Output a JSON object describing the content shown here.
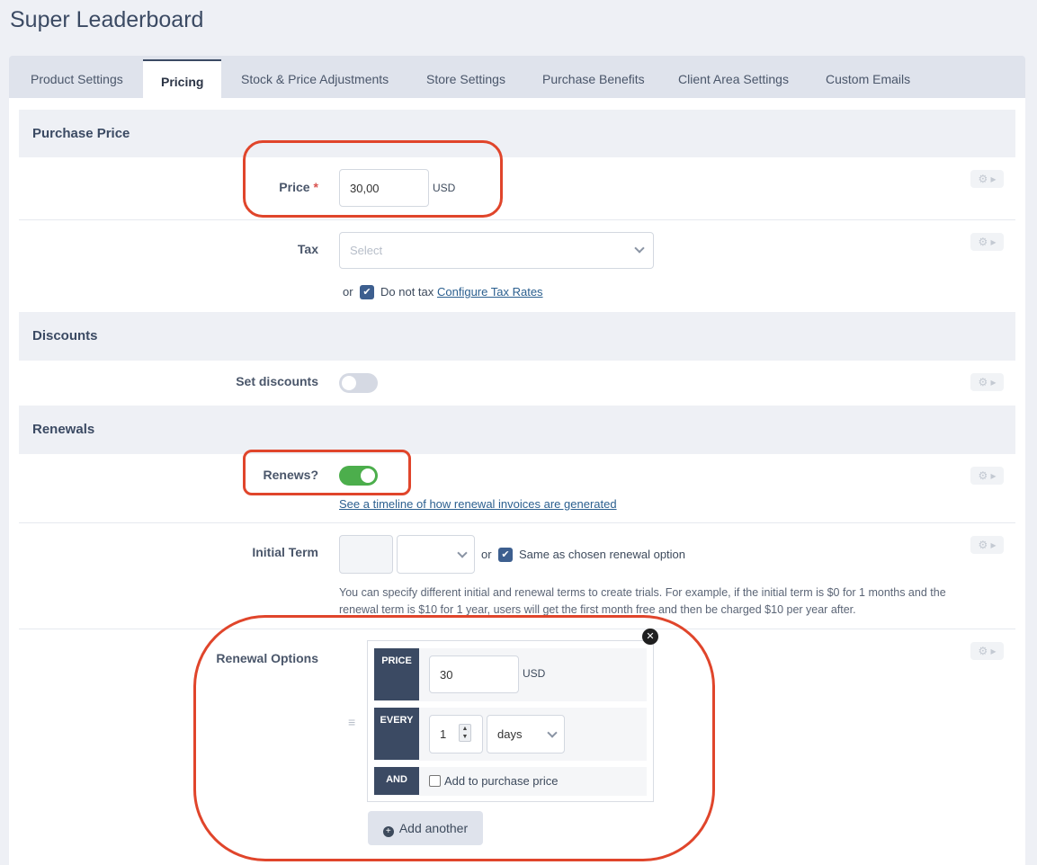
{
  "page": {
    "title": "Super Leaderboard"
  },
  "tabs": [
    {
      "label": "Product Settings"
    },
    {
      "label": "Pricing"
    },
    {
      "label": "Stock & Price Adjustments"
    },
    {
      "label": "Store Settings"
    },
    {
      "label": "Purchase Benefits"
    },
    {
      "label": "Client Area Settings"
    },
    {
      "label": "Custom Emails"
    }
  ],
  "active_tab": "Pricing",
  "purchase_price": {
    "section_title": "Purchase Price",
    "price_label": "Price",
    "required_mark": "*",
    "price_value": "30,00",
    "currency": "USD",
    "tax_label": "Tax",
    "tax_placeholder": "Select",
    "or_text": "or",
    "do_not_tax_label": "Do not tax",
    "do_not_tax_checked": true,
    "configure_tax_link": "Configure Tax Rates"
  },
  "discounts": {
    "section_title": "Discounts",
    "set_discounts_label": "Set discounts",
    "enabled": false
  },
  "renewals": {
    "section_title": "Renewals",
    "renews_label": "Renews?",
    "renews_enabled": true,
    "timeline_link": "See a timeline of how renewal invoices are generated",
    "initial_term_label": "Initial Term",
    "or_text": "or",
    "same_as_renewal_label": "Same as chosen renewal option",
    "same_as_renewal_checked": true,
    "help_text": "You can specify different initial and renewal terms to create trials. For example, if the initial term is $0 for 1 months and the renewal term is $10 for 1 year, users will get the first month free and then be charged $10 per year after.",
    "renewal_options_label": "Renewal Options",
    "option": {
      "price_tag": "PRICE",
      "price_value": "30",
      "currency": "USD",
      "every_tag": "EVERY",
      "every_value": "1",
      "period": "days",
      "and_tag": "AND",
      "add_to_purchase_label": "Add to purchase price",
      "add_to_purchase_checked": false
    },
    "add_another_label": "Add another"
  },
  "colors": {
    "accent": "#3b4a63",
    "toggle_on": "#4cae4c",
    "toggle_off": "#d5d9e3",
    "annotation": "#e0452b"
  }
}
